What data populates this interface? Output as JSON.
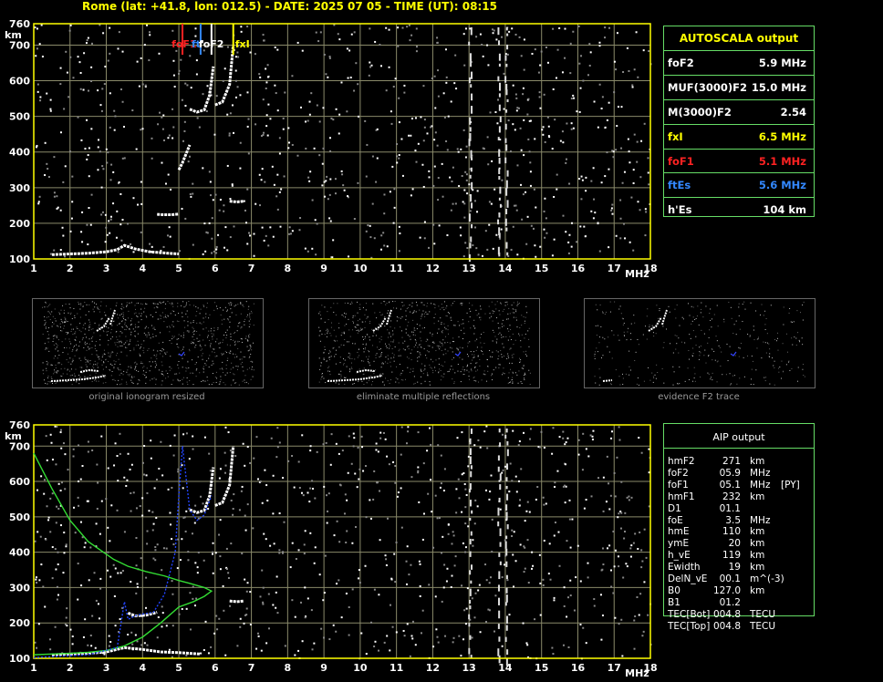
{
  "header": "Rome (lat: +41.8, lon: 012.5) - DATE: 2025 07 05 - TIME (UT): 08:15",
  "colors": {
    "grid": "#8a8a6a",
    "axis": "#ffff00",
    "foF1": "#ff2222",
    "ftEs": "#3388ff",
    "fxI": "#ffff00",
    "profile": "#33dd33",
    "trace_model": "#2244ff"
  },
  "autoscala": {
    "title": "AUTOSCALA output",
    "rows": [
      {
        "k": "foF2",
        "v": "5.9 MHz",
        "color": "#ffffff"
      },
      {
        "k": "MUF(3000)F2",
        "v": "15.0 MHz",
        "color": "#ffffff"
      },
      {
        "k": "M(3000)F2",
        "v": "2.54",
        "color": "#ffffff"
      },
      {
        "k": "fxI",
        "v": "6.5 MHz",
        "color": "#ffff00"
      },
      {
        "k": "foF1",
        "v": "5.1 MHz",
        "color": "#ff2222"
      },
      {
        "k": "ftEs",
        "v": "5.6 MHz",
        "color": "#3388ff"
      },
      {
        "k": "h'Es",
        "v": "104     km",
        "color": "#ffffff"
      }
    ]
  },
  "aip": {
    "title": "AIP output",
    "rows": [
      [
        "hmF2",
        "271",
        "km",
        ""
      ],
      [
        "foF2",
        "05.9",
        "MHz",
        ""
      ],
      [
        "foF1",
        "05.1",
        "MHz",
        "[PY]"
      ],
      [
        "hmF1",
        "232",
        "km",
        ""
      ],
      [
        "D1",
        "01.1",
        "",
        ""
      ],
      [
        "foE",
        "3.5",
        "MHz",
        ""
      ],
      [
        "hmE",
        "110",
        "km",
        ""
      ],
      [
        "ymE",
        "20",
        "km",
        ""
      ],
      [
        "h_vE",
        "119",
        "km",
        ""
      ],
      [
        "Ewidth",
        "19",
        "km",
        ""
      ],
      [
        "DelN_vE",
        "00.1",
        "m^(-3)",
        ""
      ],
      [
        "B0",
        "127.0",
        "km",
        ""
      ],
      [
        "B1",
        "01.2",
        "",
        ""
      ],
      [
        "TEC[Bot]",
        "004.8",
        "TECU",
        ""
      ],
      [
        "TEC[Top]",
        "004.8",
        "TECU",
        ""
      ]
    ]
  },
  "thumbs": [
    {
      "caption": "original ionogram resized"
    },
    {
      "caption": "eliminate multiple reflections"
    },
    {
      "caption": "evidence F2 trace"
    }
  ],
  "chart_data": [
    {
      "type": "scatter",
      "panel": "top",
      "xlabel": "MHz",
      "ylabel": "km",
      "xlim": [
        1,
        18
      ],
      "ylim": [
        100,
        760
      ],
      "xticks": [
        1,
        2,
        3,
        4,
        5,
        6,
        7,
        8,
        9,
        10,
        11,
        12,
        13,
        14,
        15,
        16,
        17,
        18
      ],
      "yticks": [
        100,
        200,
        300,
        400,
        500,
        600,
        700,
        760
      ],
      "grid": true,
      "markers": [
        {
          "name": "foF1",
          "x": 5.1,
          "color": "#ff2222"
        },
        {
          "name": "ftEs",
          "x": 5.6,
          "color": "#3388ff"
        },
        {
          "name": "foF2",
          "x": 5.9,
          "color": "#ffffff"
        },
        {
          "name": "fxI",
          "x": 6.5,
          "color": "#ffff00"
        }
      ],
      "marker_label_text": [
        "foF1",
        "ft",
        "foF2",
        "fxI"
      ],
      "trace_segments": [
        {
          "x": [
            1.5,
            2.0,
            2.5,
            3.0,
            3.3,
            3.5,
            3.8,
            4.2,
            4.7,
            5.0
          ],
          "y": [
            112,
            114,
            116,
            120,
            126,
            138,
            128,
            120,
            116,
            114
          ]
        },
        {
          "x": [
            4.4,
            4.6,
            4.8,
            5.0
          ],
          "y": [
            225,
            224,
            224,
            226
          ]
        },
        {
          "x": [
            5.0,
            5.1,
            5.2,
            5.3
          ],
          "y": [
            350,
            370,
            395,
            420
          ]
        },
        {
          "x": [
            5.3,
            5.5,
            5.7,
            5.85,
            5.95
          ],
          "y": [
            520,
            512,
            518,
            560,
            640
          ]
        },
        {
          "x": [
            6.0,
            6.2,
            6.4,
            6.5
          ],
          "y": [
            532,
            540,
            590,
            700
          ]
        },
        {
          "x": [
            6.4,
            6.6,
            6.8
          ],
          "y": [
            262,
            260,
            262
          ]
        }
      ]
    },
    {
      "type": "line",
      "panel": "bottom",
      "xlabel": "MHz",
      "ylabel": "km",
      "xlim": [
        1,
        18
      ],
      "ylim": [
        100,
        760
      ],
      "xticks": [
        1,
        2,
        3,
        4,
        5,
        6,
        7,
        8,
        9,
        10,
        11,
        12,
        13,
        14,
        15,
        16,
        17,
        18
      ],
      "yticks": [
        100,
        200,
        300,
        400,
        500,
        600,
        700,
        760
      ],
      "grid": true,
      "series": [
        {
          "color": "#33dd33",
          "x": [
            1.0,
            1.5,
            2.0,
            2.5,
            3.0,
            3.5,
            4.0,
            4.5,
            5.0,
            5.4,
            5.7,
            5.9,
            5.7,
            5.3,
            5.0,
            4.6,
            4.1,
            3.6,
            3.2,
            2.5,
            2.0,
            1.5,
            1.0
          ],
          "y": [
            110,
            112,
            114,
            117,
            122,
            135,
            160,
            200,
            245,
            260,
            275,
            290,
            300,
            312,
            320,
            333,
            345,
            360,
            380,
            430,
            490,
            580,
            680
          ]
        },
        {
          "color": "#2244ff",
          "x": [
            1.0,
            2.5,
            3.3,
            3.5,
            3.6,
            3.8,
            4.0,
            4.3,
            4.6,
            4.9,
            5.0,
            5.1,
            5.3,
            5.5,
            5.7,
            5.9
          ],
          "y": [
            102,
            110,
            130,
            260,
            210,
            220,
            225,
            230,
            280,
            400,
            560,
            700,
            520,
            490,
            505,
            560
          ]
        }
      ],
      "trace_segments": [
        {
          "x": [
            1.5,
            2.0,
            2.5,
            3.0,
            3.5,
            4.0,
            4.5,
            5.0,
            5.6
          ],
          "y": [
            110,
            112,
            114,
            118,
            130,
            125,
            118,
            116,
            112
          ]
        },
        {
          "x": [
            3.6,
            3.8,
            4.1,
            4.4
          ],
          "y": [
            228,
            220,
            222,
            230
          ]
        },
        {
          "x": [
            5.3,
            5.5,
            5.7,
            5.85,
            5.95
          ],
          "y": [
            520,
            512,
            518,
            560,
            640
          ]
        },
        {
          "x": [
            6.0,
            6.2,
            6.4,
            6.5
          ],
          "y": [
            532,
            540,
            590,
            700
          ]
        },
        {
          "x": [
            6.4,
            6.6,
            6.8
          ],
          "y": [
            262,
            260,
            262
          ]
        }
      ]
    }
  ]
}
